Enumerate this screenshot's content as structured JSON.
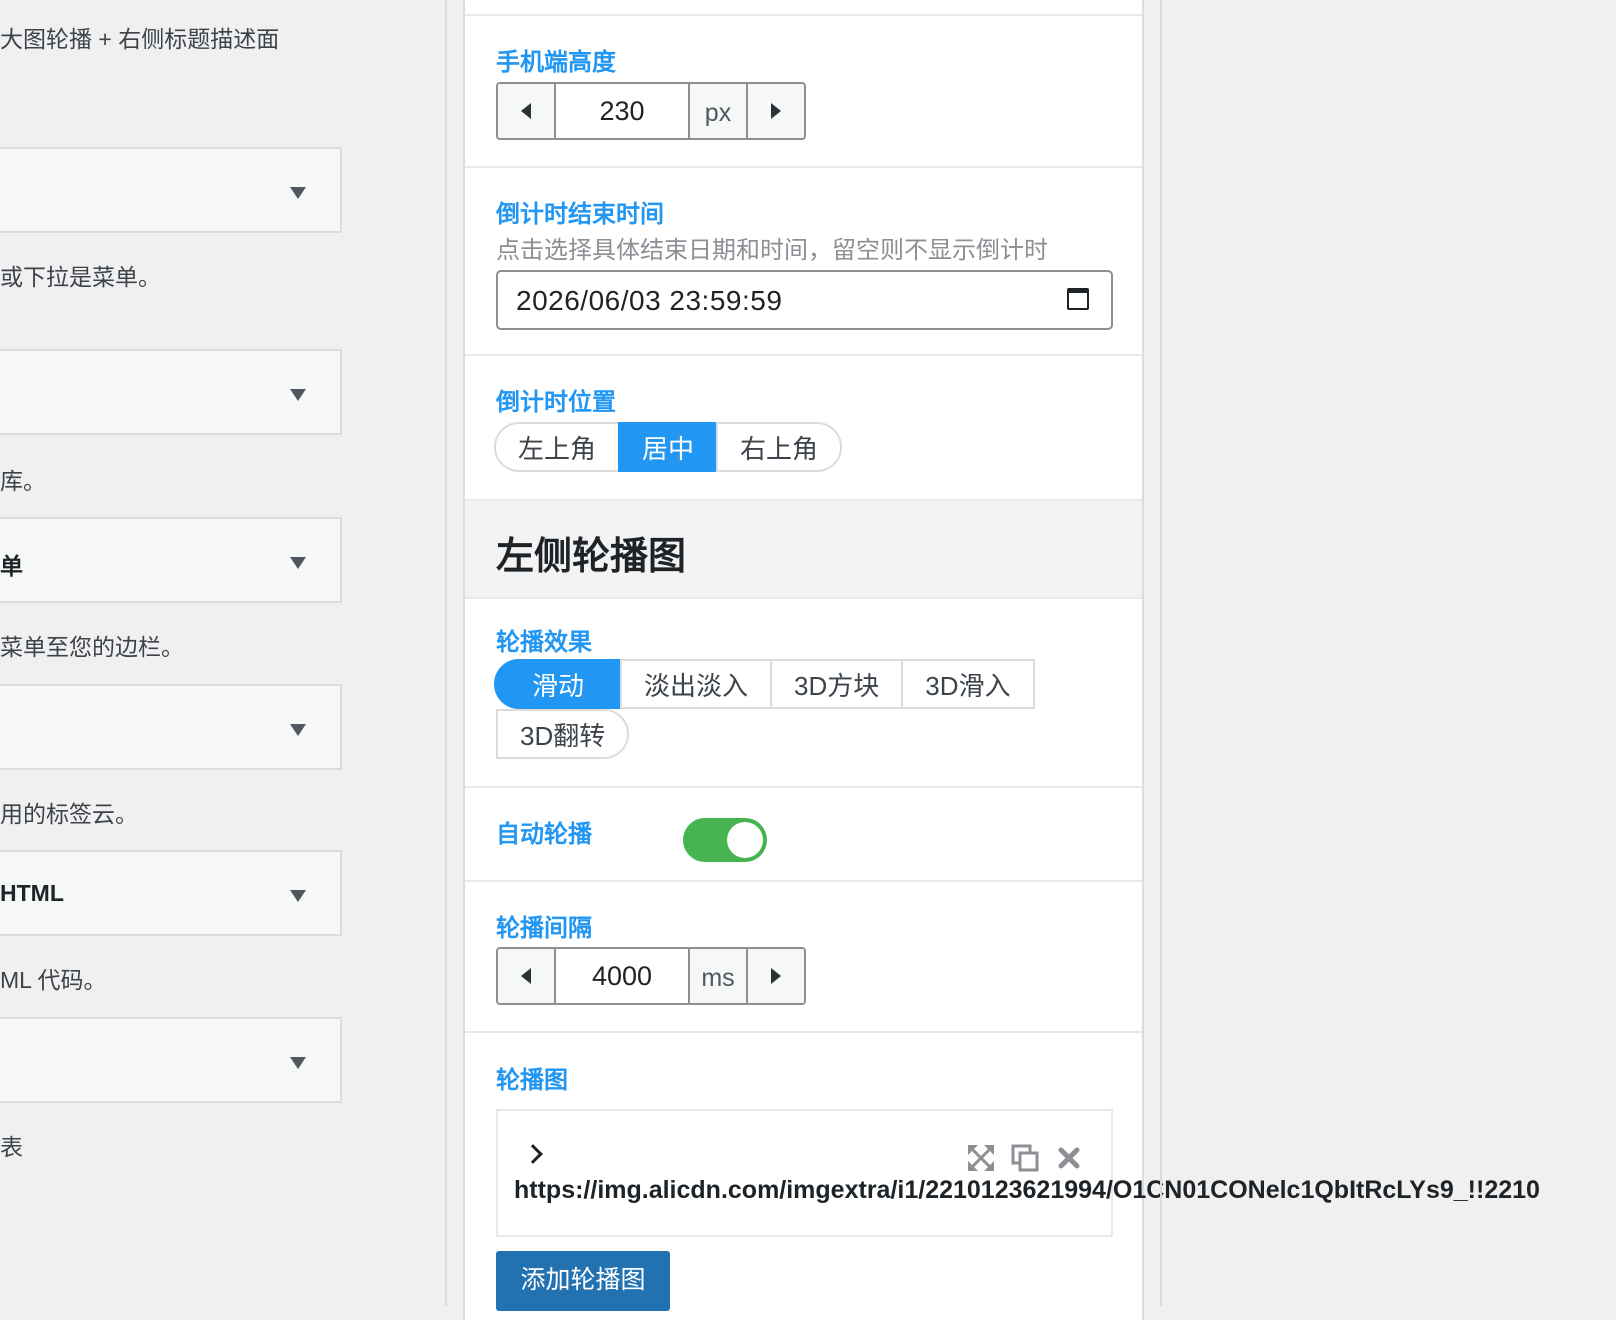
{
  "left": {
    "descs": [
      "大图轮播 + 右侧标题描述面",
      "或下拉是菜单。",
      "库。",
      "菜单至您的边栏。",
      "用的标签云。",
      "ML 代码。",
      "表"
    ],
    "widgets": [
      "",
      "",
      "单",
      "",
      "HTML",
      ""
    ]
  },
  "mobile_height": {
    "label": "手机端高度",
    "value": "230",
    "unit": "px"
  },
  "countdown_end": {
    "label": "倒计时结束时间",
    "hint": "点击选择具体结束日期和时间，留空则不显示倒计时",
    "value": "2026/06/03 23:59:59"
  },
  "countdown_position": {
    "label": "倒计时位置",
    "options": [
      "左上角",
      "居中",
      "右上角"
    ],
    "selected": "居中"
  },
  "section_title": "左侧轮播图",
  "carousel_effect": {
    "label": "轮播效果",
    "options": [
      "滑动",
      "淡出淡入",
      "3D方块",
      "3D滑入",
      "3D翻转"
    ],
    "selected": "滑动"
  },
  "autoplay": {
    "label": "自动轮播",
    "on": true
  },
  "interval": {
    "label": "轮播间隔",
    "value": "4000",
    "unit": "ms"
  },
  "carousel_images": {
    "label": "轮播图",
    "items": [
      "https://img.alicdn.com/imgextra/i1/2210123621994/O1CN01CONelc1QbItRcLYs9_!!2210"
    ],
    "add_label": "添加轮播图"
  },
  "colors": {
    "accent": "#2196f3",
    "toggle_on": "#46b450",
    "primary_button": "#2271b1"
  }
}
